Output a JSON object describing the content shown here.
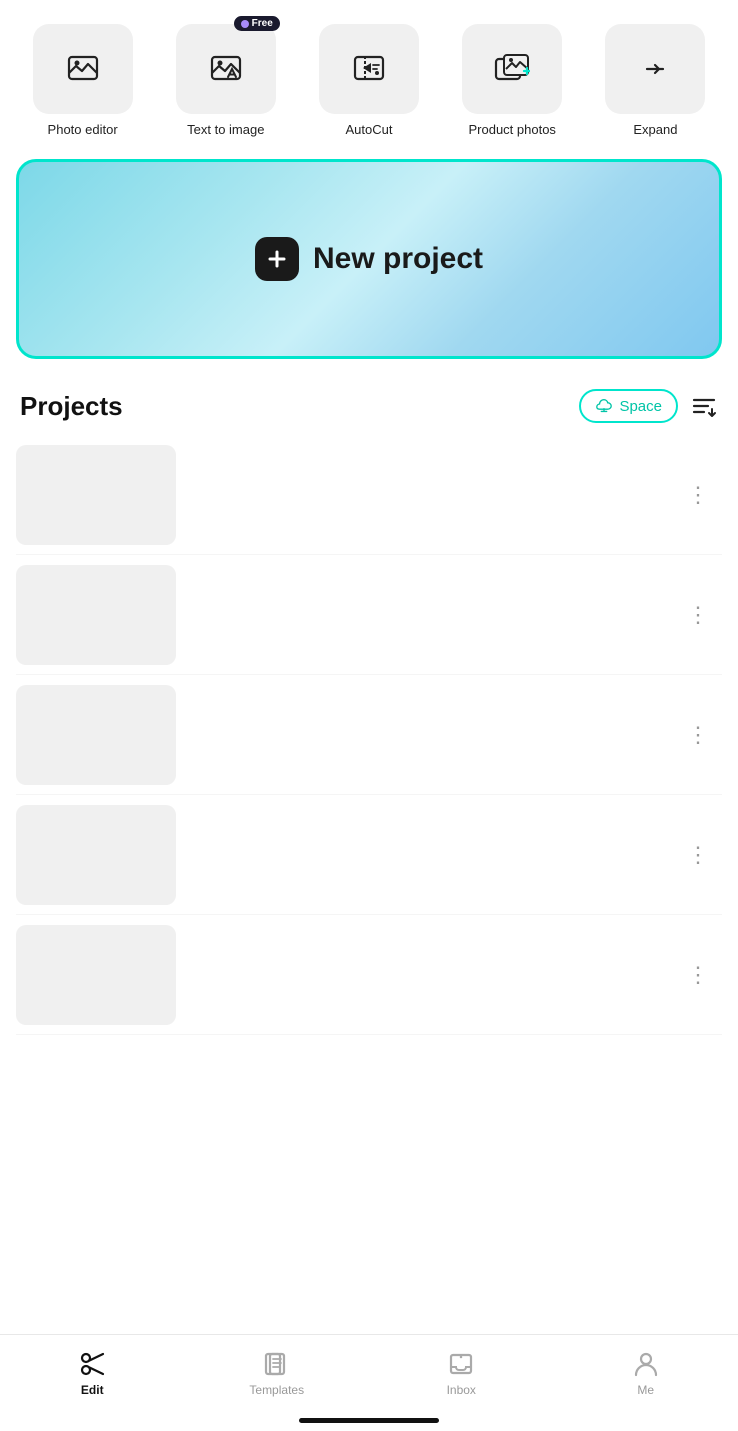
{
  "toolbar": {
    "tools": [
      {
        "id": "photo-editor",
        "label": "Photo editor",
        "icon": "photo-editor-icon",
        "badge": null
      },
      {
        "id": "text-to-image",
        "label": "Text to image",
        "icon": "text-to-image-icon",
        "badge": "Free"
      },
      {
        "id": "autocut",
        "label": "AutoCut",
        "icon": "autocut-icon",
        "badge": null
      },
      {
        "id": "product-photos",
        "label": "Product photos",
        "icon": "product-photos-icon",
        "badge": null
      },
      {
        "id": "expand",
        "label": "Expand",
        "icon": "expand-icon",
        "badge": null
      }
    ]
  },
  "new_project": {
    "label": "New project"
  },
  "projects": {
    "title": "Projects",
    "space_button": "Space",
    "rows": [
      {
        "id": 1
      },
      {
        "id": 2
      },
      {
        "id": 3
      },
      {
        "id": 4
      },
      {
        "id": 5
      }
    ]
  },
  "bottom_nav": {
    "items": [
      {
        "id": "edit",
        "label": "Edit",
        "icon": "scissors-icon",
        "active": true
      },
      {
        "id": "templates",
        "label": "Templates",
        "icon": "templates-icon",
        "active": false
      },
      {
        "id": "inbox",
        "label": "Inbox",
        "icon": "inbox-icon",
        "active": false
      },
      {
        "id": "me",
        "label": "Me",
        "icon": "me-icon",
        "active": false
      }
    ]
  },
  "colors": {
    "accent": "#00e5cc",
    "active_nav": "#111111",
    "badge_bg": "#1a1a2e"
  }
}
